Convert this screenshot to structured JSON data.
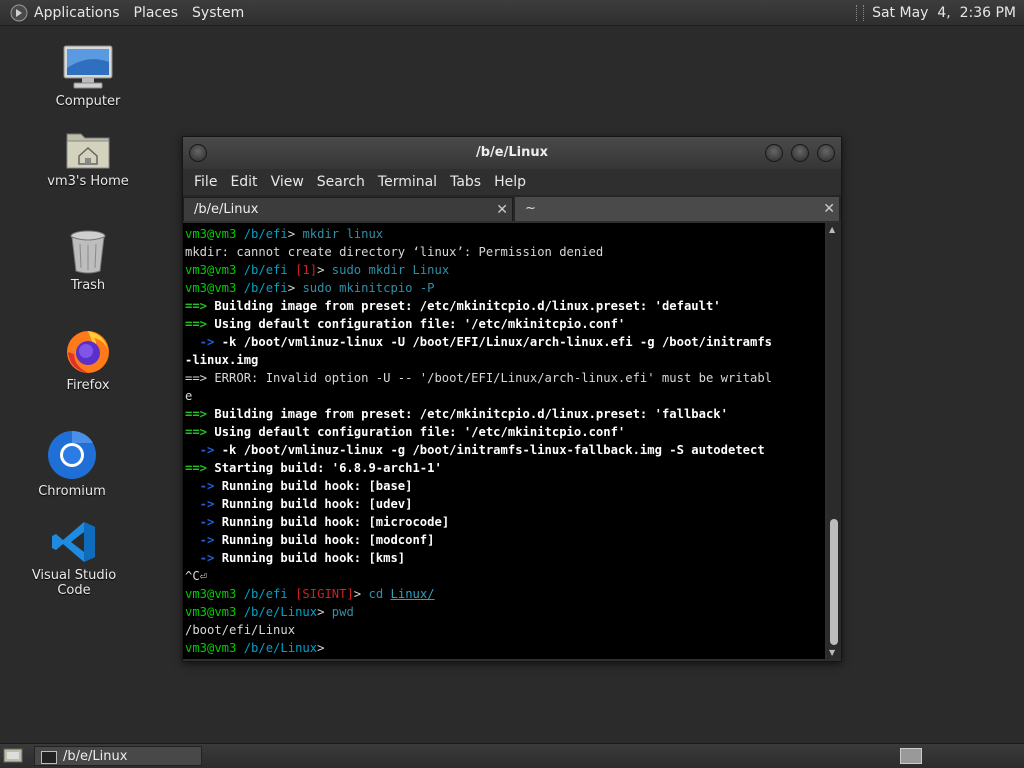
{
  "top_panel": {
    "menus": [
      "Applications",
      "Places",
      "System"
    ],
    "clock": "Sat May  4,  2:36 PM"
  },
  "desktop_icons": [
    {
      "label": "Computer",
      "icon": "computer-icon"
    },
    {
      "label": "vm3's Home",
      "icon": "home-folder-icon"
    },
    {
      "label": "Trash",
      "icon": "trash-icon"
    },
    {
      "label": "Firefox",
      "icon": "firefox-icon"
    },
    {
      "label": "Chromium",
      "icon": "chromium-icon"
    },
    {
      "label": "Visual Studio Code",
      "icon": "vscode-icon"
    }
  ],
  "terminal_window": {
    "title": "/b/e/Linux",
    "menus": [
      "File",
      "Edit",
      "View",
      "Search",
      "Terminal",
      "Tabs",
      "Help"
    ],
    "tabs": [
      {
        "label": "/b/e/Linux",
        "active": true
      },
      {
        "label": "~",
        "active": false
      }
    ],
    "lines": [
      {
        "user": "vm3@vm3",
        "path": "/b/efi",
        "status": "",
        "cmd": "mkdir linux"
      },
      {
        "text": "mkdir: cannot create directory ‘linux’: Permission denied"
      },
      {
        "user": "vm3@vm3",
        "path": "/b/efi",
        "status": "[1]",
        "cmd": "sudo mkdir Linux"
      },
      {
        "user": "vm3@vm3",
        "path": "/b/efi",
        "status": "",
        "cmd": "sudo mkinitcpio -P"
      },
      {
        "arrow": "==>",
        "text": " Building image from preset: /etc/mkinitcpio.d/linux.preset: 'default'"
      },
      {
        "arrow": "==>",
        "text": " Using default configuration file: '/etc/mkinitcpio.conf'"
      },
      {
        "sub": "  ->",
        "text": " -k /boot/vmlinuz-linux -U /boot/EFI/Linux/arch-linux.efi -g /boot/initramfs"
      },
      {
        "text": "-linux.img",
        "bold": true
      },
      {
        "text": "==> ERROR: Invalid option -U -- '/boot/EFI/Linux/arch-linux.efi' must be writabl"
      },
      {
        "text": "e"
      },
      {
        "arrow": "==>",
        "text": " Building image from preset: /etc/mkinitcpio.d/linux.preset: 'fallback'"
      },
      {
        "arrow": "==>",
        "text": " Using default configuration file: '/etc/mkinitcpio.conf'"
      },
      {
        "sub": "  ->",
        "text": " -k /boot/vmlinuz-linux -g /boot/initramfs-linux-fallback.img -S autodetect"
      },
      {
        "arrow": "==>",
        "text": " Starting build: '6.8.9-arch1-1'"
      },
      {
        "sub": "  ->",
        "text": " Running build hook: [base]"
      },
      {
        "sub": "  ->",
        "text": " Running build hook: [udev]"
      },
      {
        "sub": "  ->",
        "text": " Running build hook: [microcode]"
      },
      {
        "sub": "  ->",
        "text": " Running build hook: [modconf]"
      },
      {
        "sub": "  ->",
        "text": " Running build hook: [kms]"
      },
      {
        "text": "^C⏎"
      },
      {
        "user": "vm3@vm3",
        "path": "/b/efi",
        "status": "[SIGINT]",
        "cmd": "cd",
        "arg": "Linux/"
      },
      {
        "user": "vm3@vm3",
        "path": "/b/e/Linux",
        "status": "",
        "cmd": "pwd"
      },
      {
        "text": "/boot/efi/Linux"
      },
      {
        "user": "vm3@vm3",
        "path": "/b/e/Linux",
        "status": "",
        "cmd": ""
      }
    ]
  },
  "bottom_panel": {
    "task_label": "/b/e/Linux"
  }
}
